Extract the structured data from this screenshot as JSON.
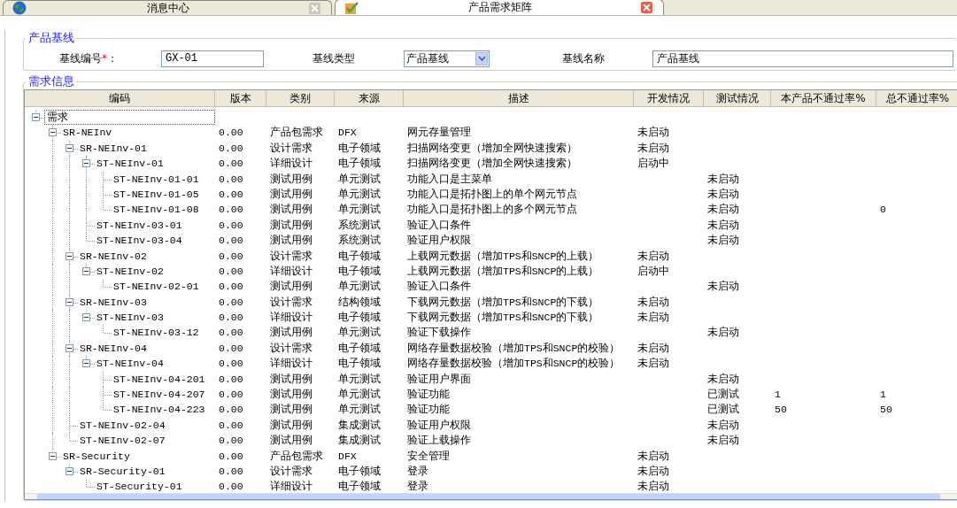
{
  "tabs": [
    {
      "label": "消息中心",
      "selected": false
    },
    {
      "label": "产品需求矩阵",
      "selected": true
    }
  ],
  "baseline": {
    "legend": "产品基线",
    "fields": [
      {
        "kind": "text",
        "label": "基线编号",
        "required_mark": "*",
        "label_suffix": "：",
        "value": "GX-01"
      },
      {
        "kind": "select",
        "label": "基线类型",
        "value": "产品基线"
      },
      {
        "kind": "text",
        "label": "基线名称",
        "value": "产品基线"
      }
    ]
  },
  "requirements": {
    "legend": "需求信息",
    "columns": [
      "编码",
      "版本",
      "类别",
      "来源",
      "描述",
      "开发情况",
      "测试情况",
      "本产品不通过率%",
      "总不通过率%"
    ],
    "tree": [
      {
        "code": "需求",
        "selected": true,
        "expanded": true,
        "children": [
          {
            "code": "SR-NEInv",
            "version": "0.00",
            "category": "产品包需求",
            "source": "DFX",
            "description": "网元存量管理",
            "dev_status": "未启动",
            "expanded": true,
            "children": [
              {
                "code": "SR-NEInv-01",
                "version": "0.00",
                "category": "设计需求",
                "source": "电子领域",
                "description": "扫描网络变更（增加全网快速搜索）",
                "dev_status": "未启动",
                "expanded": true,
                "children": [
                  {
                    "code": "ST-NEInv-01",
                    "version": "0.00",
                    "category": "详细设计",
                    "source": "电子领域",
                    "description": "扫描网络变更（增加全网快速搜索）",
                    "dev_status": "启动中",
                    "expanded": true,
                    "children": [
                      {
                        "code": "ST-NEInv-01-01",
                        "version": "0.00",
                        "category": "测试用例",
                        "source": "单元测试",
                        "description": "功能入口是主菜单",
                        "test_status": "未启动"
                      },
                      {
                        "code": "ST-NEInv-01-05",
                        "version": "0.00",
                        "category": "测试用例",
                        "source": "单元测试",
                        "description": "功能入口是拓扑图上的单个网元节点",
                        "test_status": "未启动"
                      },
                      {
                        "code": "ST-NEInv-01-08",
                        "version": "0.00",
                        "category": "测试用例",
                        "source": "单元测试",
                        "description": "功能入口是拓扑图上的多个网元节点",
                        "test_status": "未启动",
                        "total_fail_rate": "0"
                      }
                    ]
                  },
                  {
                    "code": "ST-NEInv-03-01",
                    "version": "0.00",
                    "category": "测试用例",
                    "source": "系统测试",
                    "description": "验证入口条件",
                    "test_status": "未启动"
                  },
                  {
                    "code": "ST-NEInv-03-04",
                    "version": "0.00",
                    "category": "测试用例",
                    "source": "系统测试",
                    "description": "验证用户权限",
                    "test_status": "未启动"
                  }
                ]
              },
              {
                "code": "SR-NEInv-02",
                "version": "0.00",
                "category": "设计需求",
                "source": "电子领域",
                "description": "上载网元数据（增加TPS和SNCP的上载）",
                "dev_status": "未启动",
                "expanded": true,
                "children": [
                  {
                    "code": "ST-NEInv-02",
                    "version": "0.00",
                    "category": "详细设计",
                    "source": "电子领域",
                    "description": "上载网元数据（增加TPS和SNCP的上载）",
                    "dev_status": "启动中",
                    "expanded": true,
                    "children": [
                      {
                        "code": "ST-NEInv-02-01",
                        "version": "0.00",
                        "category": "测试用例",
                        "source": "单元测试",
                        "description": "验证入口条件",
                        "test_status": "未启动"
                      }
                    ]
                  }
                ]
              },
              {
                "code": "SR-NEInv-03",
                "version": "0.00",
                "category": "设计需求",
                "source": "结构领域",
                "description": "下载网元数据（增加TPS和SNCP的下载）",
                "dev_status": "未启动",
                "expanded": true,
                "children": [
                  {
                    "code": "ST-NEInv-03",
                    "version": "0.00",
                    "category": "详细设计",
                    "source": "电子领域",
                    "description": "下载网元数据（增加TPS和SNCP的下载）",
                    "dev_status": "未启动",
                    "expanded": true,
                    "children": [
                      {
                        "code": "ST-NEInv-03-12",
                        "version": "0.00",
                        "category": "测试用例",
                        "source": "单元测试",
                        "description": "验证下载操作",
                        "test_status": "未启动"
                      }
                    ]
                  }
                ]
              },
              {
                "code": "SR-NEInv-04",
                "version": "0.00",
                "category": "设计需求",
                "source": "电子领域",
                "description": "网络存量数据校验（增加TPS和SNCP的校验）",
                "dev_status": "未启动",
                "expanded": true,
                "children": [
                  {
                    "code": "ST-NEInv-04",
                    "version": "0.00",
                    "category": "详细设计",
                    "source": "电子领域",
                    "description": "网络存量数据校验（增加TPS和SNCP的校验）",
                    "dev_status": "未启动",
                    "expanded": true,
                    "children": [
                      {
                        "code": "ST-NEInv-04-201",
                        "version": "0.00",
                        "category": "测试用例",
                        "source": "单元测试",
                        "description": "验证用户界面",
                        "test_status": "未启动"
                      },
                      {
                        "code": "ST-NEInv-04-207",
                        "version": "0.00",
                        "category": "测试用例",
                        "source": "单元测试",
                        "description": "验证功能",
                        "test_status": "已测试",
                        "product_fail_rate": "1",
                        "total_fail_rate": "1"
                      },
                      {
                        "code": "ST-NEInv-04-223",
                        "version": "0.00",
                        "category": "测试用例",
                        "source": "单元测试",
                        "description": "验证功能",
                        "test_status": "已测试",
                        "product_fail_rate": "50",
                        "total_fail_rate": "50"
                      }
                    ]
                  }
                ]
              },
              {
                "code": "ST-NEInv-02-04",
                "version": "0.00",
                "category": "测试用例",
                "source": "集成测试",
                "description": "验证用户权限",
                "test_status": "未启动"
              },
              {
                "code": "ST-NEInv-02-07",
                "version": "0.00",
                "category": "测试用例",
                "source": "集成测试",
                "description": "验证上载操作",
                "test_status": "未启动"
              }
            ]
          },
          {
            "code": "SR-Security",
            "version": "0.00",
            "category": "产品包需求",
            "source": "DFX",
            "description": "安全管理",
            "dev_status": "未启动",
            "expanded": true,
            "children": [
              {
                "code": "SR-Security-01",
                "version": "0.00",
                "category": "设计需求",
                "source": "电子领域",
                "description": "登录",
                "dev_status": "未启动",
                "expanded": true,
                "children": [
                  {
                    "code": "ST-Security-01",
                    "version": "0.00",
                    "category": "详细设计",
                    "source": "电子领域",
                    "description": "登录",
                    "dev_status": "未启动"
                  }
                ]
              }
            ]
          }
        ]
      }
    ]
  }
}
